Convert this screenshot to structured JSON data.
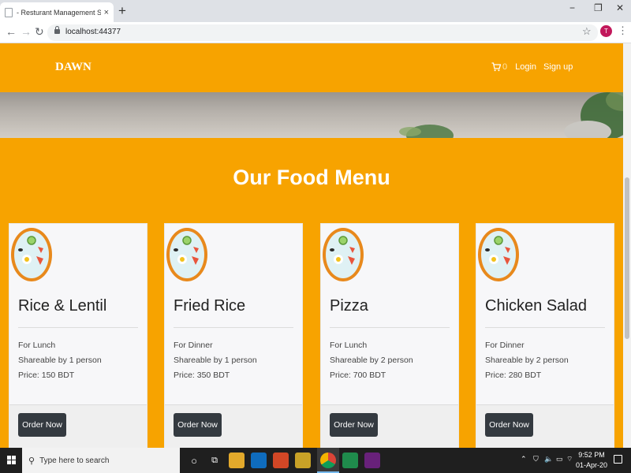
{
  "browser": {
    "tab_title": "- Resturant Management System",
    "tab_close": "×",
    "new_tab": "+",
    "url": "localhost:44377",
    "profile_initial": "T",
    "window_controls": {
      "minimize": "−",
      "restore": "❐",
      "close": "✕"
    }
  },
  "site": {
    "brand": "DAWN",
    "cart_count": "0",
    "nav_login": "Login",
    "nav_signup": "Sign up",
    "menu_title": "Our Food Menu",
    "order_label": "Order Now",
    "items": [
      {
        "name": "Rice & Lentil",
        "meal": "For Lunch",
        "share": "Shareable by 1 person",
        "price": "Price: 150 BDT"
      },
      {
        "name": "Fried Rice",
        "meal": "For Dinner",
        "share": "Shareable by 1 person",
        "price": "Price: 350 BDT"
      },
      {
        "name": "Pizza",
        "meal": "For Lunch",
        "share": "Shareable by 2 person",
        "price": "Price: 700 BDT"
      },
      {
        "name": "Chicken Salad",
        "meal": "For Dinner",
        "share": "Shareable by 2 person",
        "price": "Price: 280 BDT"
      }
    ]
  },
  "taskbar": {
    "search_placeholder": "Type here to search",
    "time": "9:52 PM",
    "date": "01-Apr-20"
  },
  "colors": {
    "accent": "#f7a300",
    "button": "#343a40",
    "card": "#f7f7f9"
  }
}
